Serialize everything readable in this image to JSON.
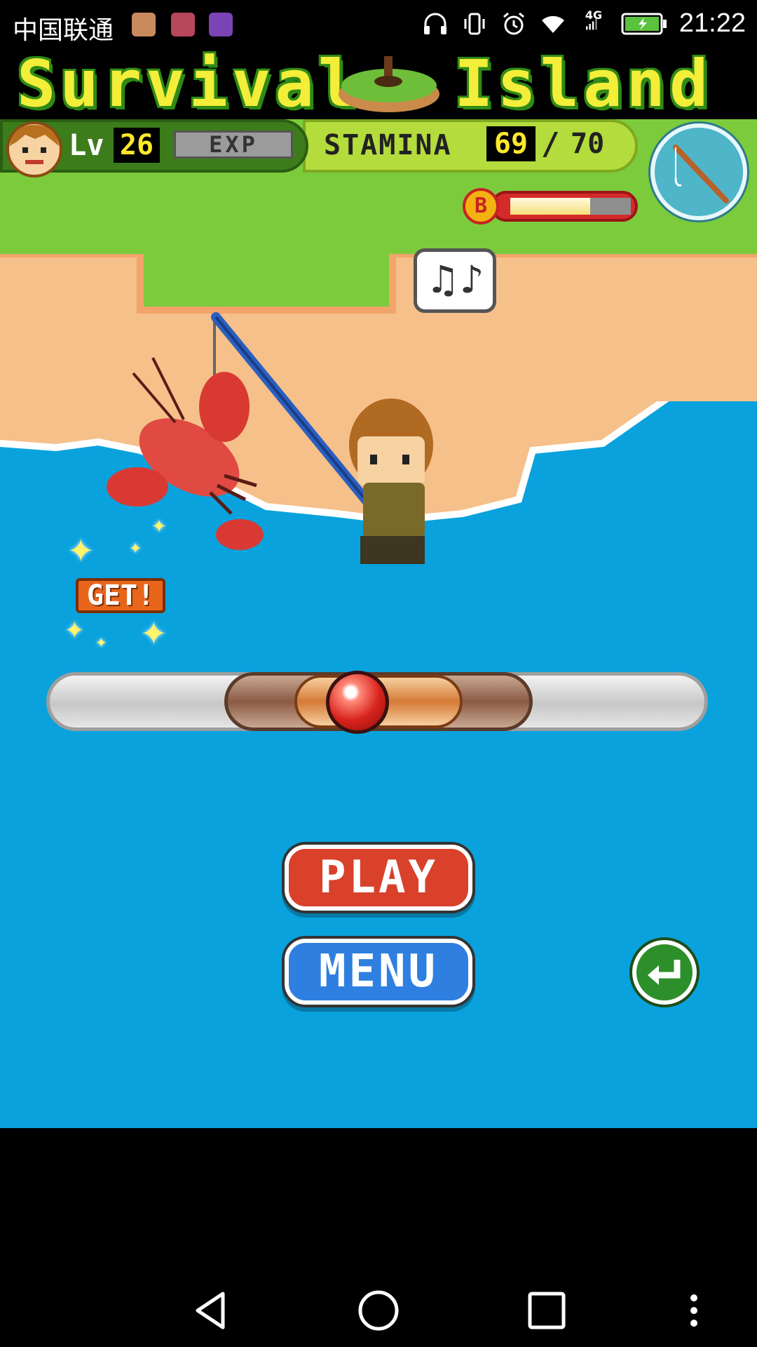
{
  "status_bar": {
    "carrier": "中国联通",
    "time": "21:22",
    "network": "4G",
    "app_icons": [
      "music-app-icon",
      "health-app-icon",
      "gallery-app-icon"
    ],
    "right_icons": [
      "headphones-icon",
      "vibrate-icon",
      "alarm-icon",
      "wifi-icon",
      "signal-icon",
      "battery-icon"
    ]
  },
  "game": {
    "title": "Survival Island",
    "title_left": "Survival",
    "title_right": "Island",
    "hud": {
      "level_label": "Lv",
      "level": "26",
      "exp_label": "EXP",
      "stamina_label": "STAMINA",
      "stamina_current": "69",
      "stamina_separator": "/",
      "stamina_max": "70",
      "bait_icon_letter": "B",
      "bait_gauge_fraction": 0.66
    },
    "speech_bubble": "♫♪",
    "catch_badge": "GET!",
    "tension_gauge": {
      "ball_position_fraction": 0.47
    },
    "buttons": {
      "play_label": "PLAY",
      "menu_label": "MENU"
    }
  },
  "colors": {
    "sea": "#0aa2dd",
    "grass": "#7ccb3c",
    "sand": "#f6c08a",
    "play_button": "#d9412b",
    "menu_button": "#2f7fe0",
    "back_button": "#2d8f2a",
    "title_yellow": "#f3ee3a"
  },
  "nav_bar": {
    "buttons": [
      "back-icon",
      "home-icon",
      "recents-icon",
      "more-icon"
    ]
  }
}
